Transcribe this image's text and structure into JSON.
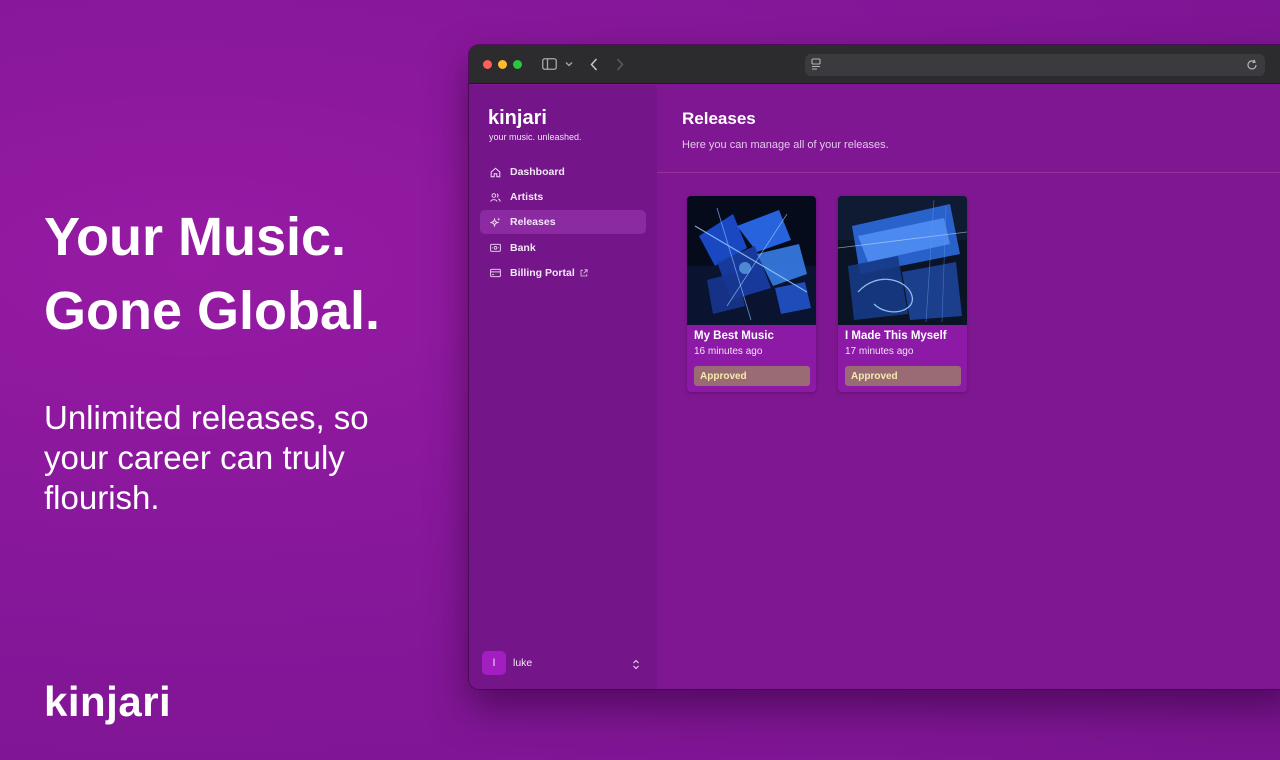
{
  "hero": {
    "line1": "Your Music.",
    "line2": "Gone Global.",
    "subtitle": "Unlimited releases, so your career can truly flourish.",
    "brand": "kinjari"
  },
  "app": {
    "logo": "kinjari",
    "tagline": "your music. unleashed.",
    "nav": [
      {
        "label": "Dashboard",
        "icon": "home-icon"
      },
      {
        "label": "Artists",
        "icon": "users-icon"
      },
      {
        "label": "Releases",
        "icon": "sparkles-icon",
        "active": true
      },
      {
        "label": "Bank",
        "icon": "bank-icon"
      },
      {
        "label": "Billing Portal",
        "icon": "card-icon",
        "external": true
      }
    ],
    "user": {
      "initial": "l",
      "name": "luke"
    }
  },
  "page": {
    "title": "Releases",
    "subtitle": "Here you can manage all of your releases."
  },
  "releases": [
    {
      "title": "My Best Music",
      "time": "16 minutes ago",
      "status": "Approved"
    },
    {
      "title": "I Made This Myself",
      "time": "17 minutes ago",
      "status": "Approved"
    }
  ],
  "colors": {
    "background": "#86179a",
    "sidebar": "#74168a",
    "card": "#8c1aa6",
    "status_badge": "#9a6b74",
    "status_text": "#f4ecae"
  }
}
